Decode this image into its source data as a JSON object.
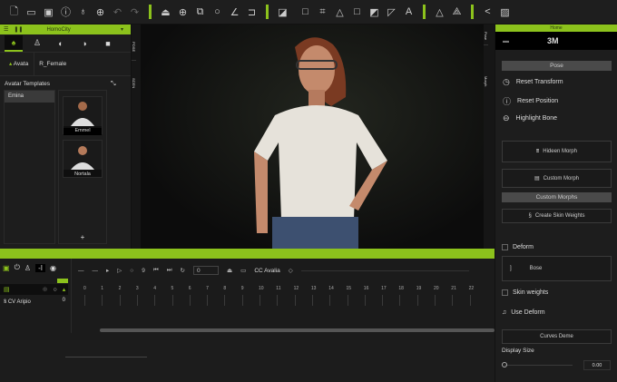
{
  "toolbar": {
    "icons": [
      "new-file",
      "open",
      "save",
      "info",
      "microphone",
      "globe",
      "undo",
      "redo",
      "stamp",
      "target",
      "cube-edit",
      "circle",
      "pen",
      "frame",
      "image",
      "square",
      "square-frame",
      "cone",
      "square2",
      "edit-box",
      "slash-box",
      "text-a",
      "triangle",
      "triangle-light",
      "share",
      "panel"
    ]
  },
  "left": {
    "title": "HomoCity",
    "tab_icons": [
      "avatar",
      "person",
      "circle",
      "globe",
      "camera"
    ],
    "sub_tab1": "Avata",
    "sub_tab2": "R_Female",
    "templates_label": "Avatar Templates",
    "list": [
      "Emina"
    ],
    "thumbs": [
      "Emmel",
      "Nortala"
    ],
    "add_label": "+",
    "side_tabs": [
      "POSE",
      "SCEN"
    ]
  },
  "right": {
    "header": "Home",
    "title": "3M",
    "side_tabs": [
      "Pose",
      "Morph"
    ],
    "pose_section": "Pose",
    "actions": [
      "Reset Transform",
      "Reset Position",
      "Highlight Bone"
    ],
    "hidden_morph": "Hideen Morph",
    "custom_morph": "Custom Morph",
    "custom_morphs_section": "Custom Morphs",
    "create_skin": "Create Skin Weights",
    "deform": "Deform",
    "bose": "Bose",
    "skin_weights": "Skin weights",
    "use_deform": "Use Deform",
    "curves": "Curves Deme",
    "display_size": "Display Size",
    "display_value": "0.00"
  },
  "timeline": {
    "frame_value": "0",
    "track_name_label": "CC Avalia",
    "row_label": "CV Aripio",
    "row_value": "0",
    "ticks": [
      "0",
      "1",
      "2",
      "3",
      "4",
      "5",
      "6",
      "7",
      "8",
      "9",
      "10",
      "11",
      "12",
      "13",
      "14",
      "15",
      "16",
      "17",
      "18",
      "19",
      "20",
      "21",
      "22"
    ]
  },
  "colors": {
    "accent": "#8cc21c"
  }
}
